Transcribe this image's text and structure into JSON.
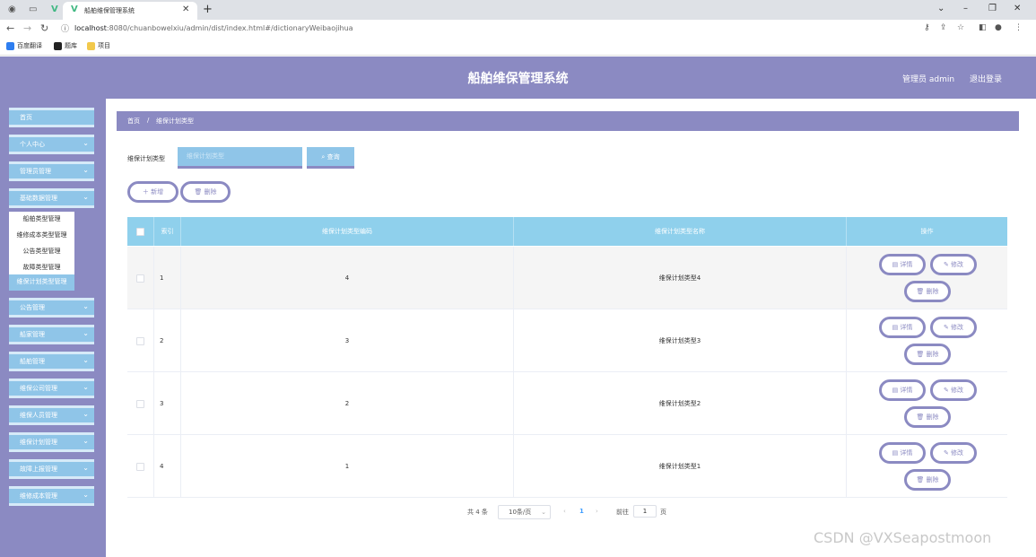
{
  "browser": {
    "tab_title": "船舶维保管理系统",
    "url_host": "localhost",
    "url_rest": ":8080/chuanbowelxiu/admin/dist/index.html#/dictionaryWeibaojihua",
    "bookmarks": [
      "百度翻译",
      "题库",
      "项目"
    ]
  },
  "header": {
    "title": "船舶维保管理系统",
    "user": "管理员 admin",
    "logout": "退出登录"
  },
  "sidebar": {
    "items": [
      {
        "label": "首页",
        "has_chevron": false
      },
      {
        "label": "个人中心",
        "has_chevron": true
      },
      {
        "label": "管理员管理",
        "has_chevron": true
      },
      {
        "label": "基础数据管理",
        "has_chevron": true
      },
      {
        "label": "公告管理",
        "has_chevron": true
      },
      {
        "label": "船家管理",
        "has_chevron": true
      },
      {
        "label": "船舶管理",
        "has_chevron": true
      },
      {
        "label": "维保公司管理",
        "has_chevron": true
      },
      {
        "label": "维保人员管理",
        "has_chevron": true
      },
      {
        "label": "维保计划管理",
        "has_chevron": true
      },
      {
        "label": "故障上报管理",
        "has_chevron": true
      },
      {
        "label": "维修成本管理",
        "has_chevron": true
      }
    ],
    "submenu": [
      {
        "label": "船舶类型管理",
        "active": false
      },
      {
        "label": "维修成本类型管理",
        "active": false
      },
      {
        "label": "公告类型管理",
        "active": false
      },
      {
        "label": "故障类型管理",
        "active": false
      },
      {
        "label": "维保计划类型管理",
        "active": true
      }
    ]
  },
  "breadcrumb": {
    "home": "首页",
    "sep": "/",
    "current": "维保计划类型"
  },
  "search": {
    "label": "维保计划类型",
    "placeholder": "维保计划类型",
    "button": "查询"
  },
  "actions": {
    "add": "新增",
    "delete": "删除"
  },
  "table": {
    "headers": {
      "index": "索引",
      "code": "维保计划类型编码",
      "name": "维保计划类型名称",
      "ops": "操作"
    },
    "rows": [
      {
        "index": "1",
        "code": "4",
        "name": "维保计划类型4"
      },
      {
        "index": "2",
        "code": "3",
        "name": "维保计划类型3"
      },
      {
        "index": "3",
        "code": "2",
        "name": "维保计划类型2"
      },
      {
        "index": "4",
        "code": "1",
        "name": "维保计划类型1"
      }
    ],
    "row_buttons": {
      "detail": "详情",
      "edit": "修改",
      "delete": "删除"
    }
  },
  "pagination": {
    "total": "共 4 条",
    "page_size": "10条/页",
    "current_page": "1",
    "goto_prefix": "前往",
    "goto_value": "1",
    "goto_suffix": "页"
  },
  "watermark": "CSDN @VXSeapostmoon",
  "colors": {
    "header_bg": "#8b8ac2",
    "menu_bg": "#8fc5e8",
    "table_head_bg": "#8fd0ec"
  }
}
